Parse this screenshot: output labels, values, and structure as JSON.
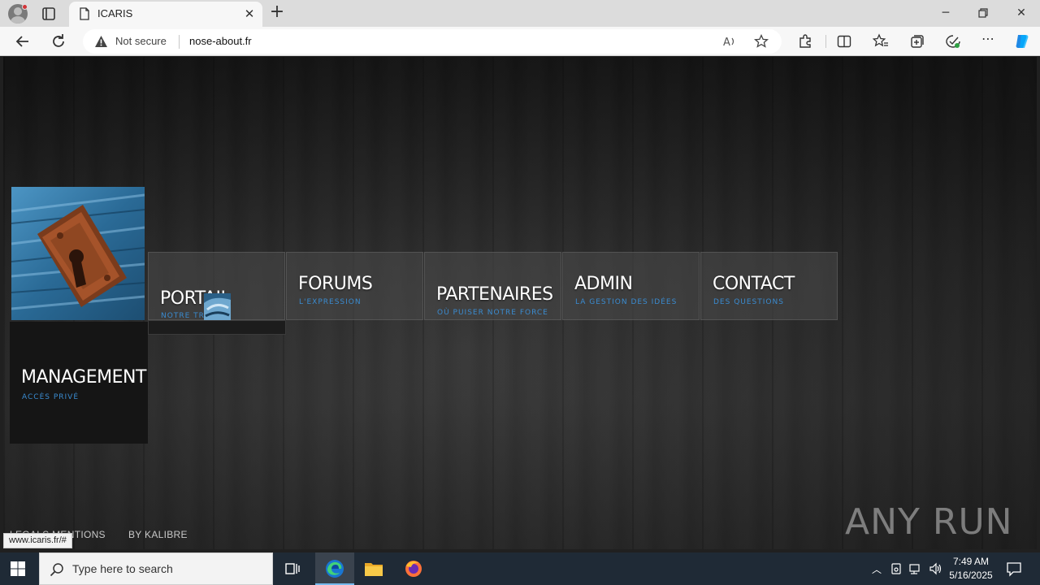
{
  "browser": {
    "tab_title": "ICARIS",
    "security_label": "Not secure",
    "url": "nose-about.fr",
    "status_url": "www.icaris.fr/#"
  },
  "site": {
    "nav": [
      {
        "title": "PORTAIL",
        "subtitle": "NOTRE TRAVAIL"
      },
      {
        "title": "FORUMS",
        "subtitle": "L'EXPRESSION"
      },
      {
        "title": "PARTENAIRES",
        "subtitle": "OÙ PUISER NOTRE FORCE"
      },
      {
        "title": "ADMIN",
        "subtitle": "LA GESTION DES IDÉES"
      },
      {
        "title": "CONTACT",
        "subtitle": "DES QUESTIONS"
      }
    ],
    "management": {
      "title": "MANAGEMENT",
      "subtitle": "ACCÈS PRIVÉ"
    },
    "footer": {
      "legal": "LEGALS MENTIONS",
      "credit": "BY KALIBRE"
    },
    "watermark": "ANY RUN"
  },
  "taskbar": {
    "search_placeholder": "Type here to search",
    "time": "7:49 AM",
    "date": "5/16/2025"
  },
  "colors": {
    "accent_blue": "#3a8bd0",
    "taskbar": "#1f2a36"
  }
}
